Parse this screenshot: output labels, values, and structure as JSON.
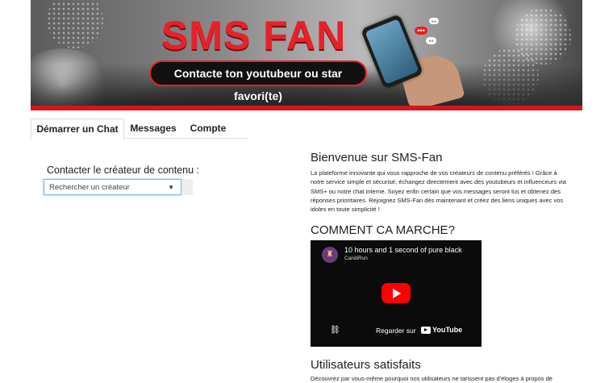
{
  "banner": {
    "title": "SMS FAN",
    "tagline": "Contacte ton youtubeur ou star favori(te)",
    "accent_color": "#e8202a"
  },
  "tabs": [
    {
      "label": "Démarrer un Chat",
      "active": true
    },
    {
      "label": "Messages",
      "active": false
    },
    {
      "label": "Compte",
      "active": false
    }
  ],
  "contact": {
    "label": "Contacter le créateur de contenu :",
    "select_placeholder": "Rechercher un créateur"
  },
  "welcome": {
    "title": "Bienvenue sur SMS-Fan",
    "text": "La plateforme innovante qui vous rapproche de vos créateurs de contenu préférés ! Grâce à notre service simple et sécurisé, échangez directement avec des youtubeurs et influenceurs via SMS+ ou notre chat interne. Soyez enfin certain que vos messages seront lus et obtenez des réponses prioritaires. Rejoignez SMS-Fan dès maintenant et créez des liens uniques avec vos idoles en toute simplicité !"
  },
  "how": {
    "title": "COMMENT CA MARCHE?",
    "video": {
      "title": "10 hours and 1 second of pure black",
      "channel": "CandiRun",
      "watch_on": "Regarder sur",
      "platform": "YouTube"
    }
  },
  "users": {
    "title": "Utilisateurs satisfaits",
    "text": "Découvrez par vous-même pourquoi nos utilisateurs ne tarissent pas d'éloges à propos de"
  }
}
